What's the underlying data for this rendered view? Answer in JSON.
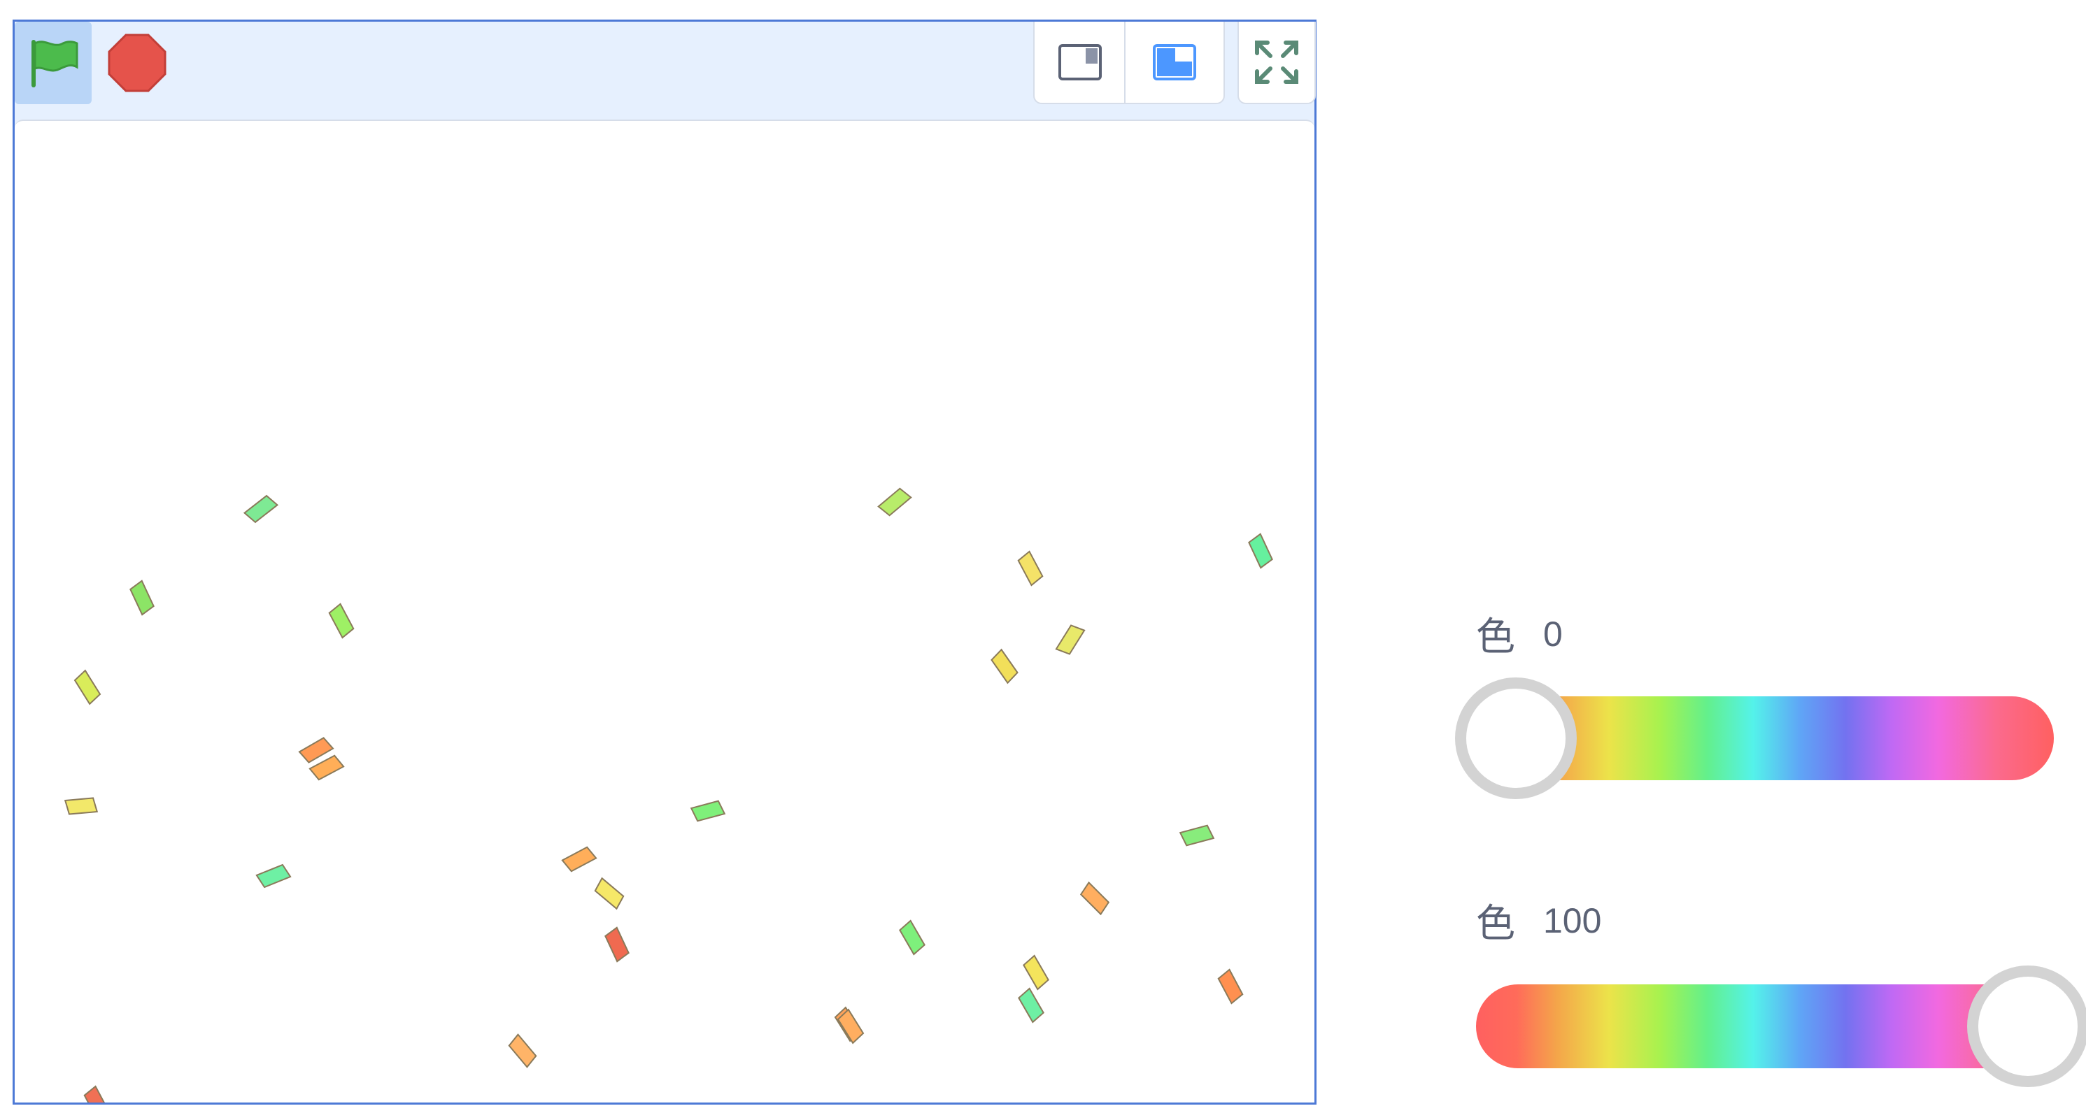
{
  "toolbar": {
    "green_flag_icon": "green-flag-icon",
    "stop_icon": "stop-sign-icon",
    "small_stage_icon": "small-stage-icon",
    "large_stage_icon": "large-stage-icon",
    "fullscreen_icon": "fullscreen-icon"
  },
  "colors": {
    "accent_border": "#4d79d6",
    "header_bg": "#e6f0fe",
    "green_flag": "#4cbb4c",
    "stop": "#e5534b",
    "mode_active": "#4c97ff"
  },
  "stage": {
    "confetti": [
      {
        "color": "#7eea94"
      },
      {
        "color": "#8ce466"
      },
      {
        "color": "#9ef065"
      },
      {
        "color": "#d9ec5a"
      },
      {
        "color": "#ff9a55"
      },
      {
        "color": "#ffae58"
      },
      {
        "color": "#f2e86a"
      },
      {
        "color": "#6ef0a4"
      },
      {
        "color": "#f07055"
      },
      {
        "color": "#b8ec6a"
      },
      {
        "color": "#f4e268"
      },
      {
        "color": "#66f09e"
      },
      {
        "color": "#f2df5a"
      },
      {
        "color": "#e8e96a"
      },
      {
        "color": "#88ec7c"
      },
      {
        "color": "#7ff07a"
      },
      {
        "color": "#ffae5a"
      },
      {
        "color": "#f6e868"
      },
      {
        "color": "#f06a50"
      },
      {
        "color": "#ffae60"
      },
      {
        "color": "#7ef07c"
      },
      {
        "color": "#f4e45c"
      },
      {
        "color": "#6ef0a4"
      },
      {
        "color": "#ffa25a"
      },
      {
        "color": "#ff9050"
      },
      {
        "color": "#ffae60"
      },
      {
        "color": "#ffb468"
      }
    ]
  },
  "sliders": [
    {
      "label": "色",
      "value": "0",
      "level": 0
    },
    {
      "label": "色",
      "value": "100",
      "level": 100
    }
  ]
}
